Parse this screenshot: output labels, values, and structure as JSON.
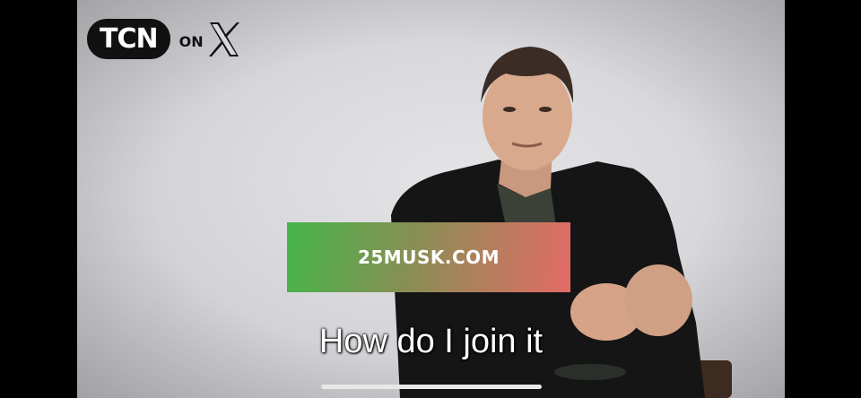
{
  "logo": {
    "brand": "TCN",
    "on": "ON",
    "platform": "X"
  },
  "banner": {
    "text": "25MUSK.COM"
  },
  "caption": {
    "text": "How do I join it"
  },
  "colors": {
    "banner_start": "#45b54a",
    "banner_end": "#e46b66",
    "background": "#000000"
  }
}
